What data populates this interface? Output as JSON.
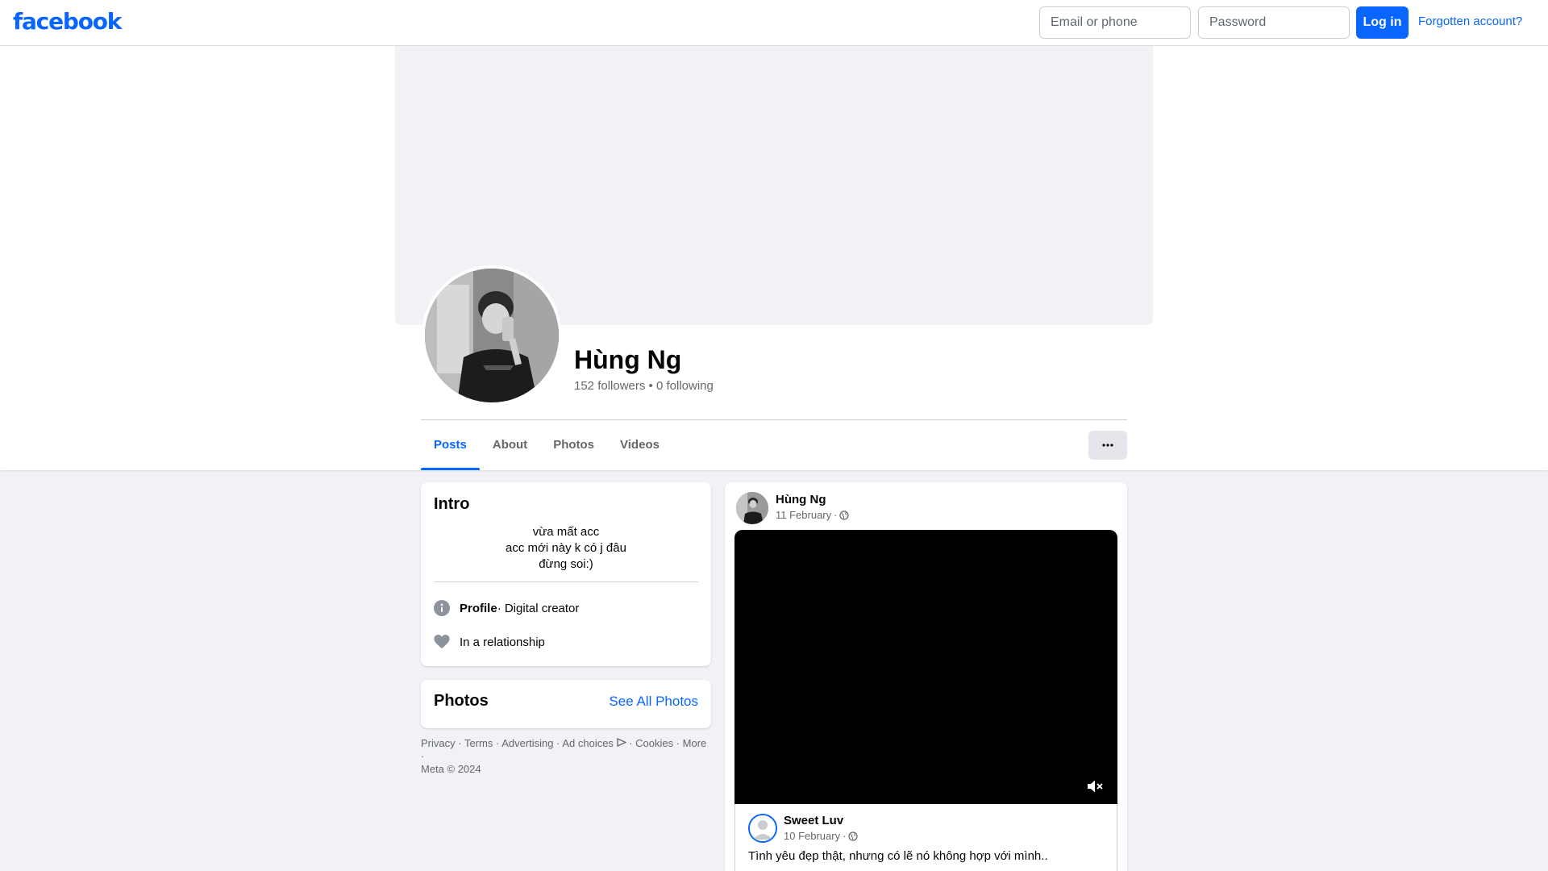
{
  "topbar": {
    "logo": "facebook",
    "email_placeholder": "Email or phone",
    "password_placeholder": "Password",
    "login_label": "Log in",
    "forgot_label": "Forgotten account?"
  },
  "profile": {
    "name": "Hùng Ng",
    "followers": "152 followers",
    "separator": " • ",
    "following": "0 following"
  },
  "tabs": [
    {
      "label": "Posts",
      "active": true
    },
    {
      "label": "About",
      "active": false
    },
    {
      "label": "Photos",
      "active": false
    },
    {
      "label": "Videos",
      "active": false
    }
  ],
  "more_label": "···",
  "intro": {
    "title": "Intro",
    "bio": [
      "vừa mất acc",
      "acc mới này k có j đâu",
      "đừng soi:)"
    ],
    "profile_label": "Profile",
    "profile_detail": " · Digital creator",
    "relationship": "In a relationship",
    "profile_icon": "info-icon",
    "relationship_icon": "heart-icon"
  },
  "photos": {
    "title": "Photos",
    "see_all": "See All Photos"
  },
  "footer": {
    "privacy": "Privacy",
    "terms": "Terms",
    "advertising": "Advertising",
    "ad_choices": "Ad choices",
    "cookies": "Cookies",
    "more": "More",
    "copyright": "Meta © 2024"
  },
  "post": {
    "author": "Hùng Ng",
    "date": "11 February",
    "audience_icon": "globe-icon",
    "mute_icon": "mute-icon",
    "shared": {
      "author": "Sweet Luv",
      "date": "10 February",
      "text": "Tình yêu đẹp thật, nhưng có lẽ nó không hợp với mình.."
    }
  },
  "colors": {
    "brand": "#0866ff",
    "page_bg": "#f0f2f5",
    "secondary_text": "#65676b"
  }
}
